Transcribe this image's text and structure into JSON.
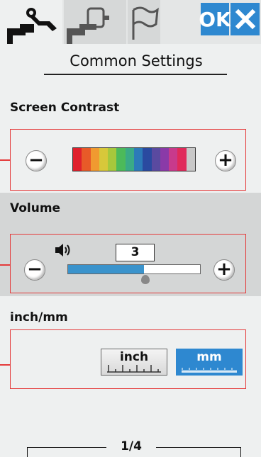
{
  "tabs": [
    {
      "name": "machine-settings",
      "icon": "sewing-machine-wrench-icon",
      "active": true
    },
    {
      "name": "embroidery-settings",
      "icon": "embroidery-machine-icon",
      "active": false
    },
    {
      "name": "language-settings",
      "icon": "flag-icon",
      "active": false
    }
  ],
  "ok_label": "OK",
  "title": "Common Settings",
  "contrast": {
    "label": "Screen Contrast",
    "colors": [
      "#e0202c",
      "#e85a28",
      "#f09a30",
      "#d8c83a",
      "#a6c83c",
      "#4cba5a",
      "#3aaa86",
      "#2c7ab8",
      "#2a4aa0",
      "#5a4aa0",
      "#8a3aa8",
      "#c83a8c",
      "#e02a5a",
      "#c8c8c8"
    ]
  },
  "volume": {
    "label": "Volume",
    "value": "3",
    "level_fraction": 0.58
  },
  "units": {
    "label": "inch/mm",
    "inch_label": "inch",
    "mm_label": "mm",
    "selected": "mm"
  },
  "page_indicator": "1/4",
  "colors": {
    "accent_blue": "#2e88d0",
    "highlight_red": "#e43a3a"
  }
}
